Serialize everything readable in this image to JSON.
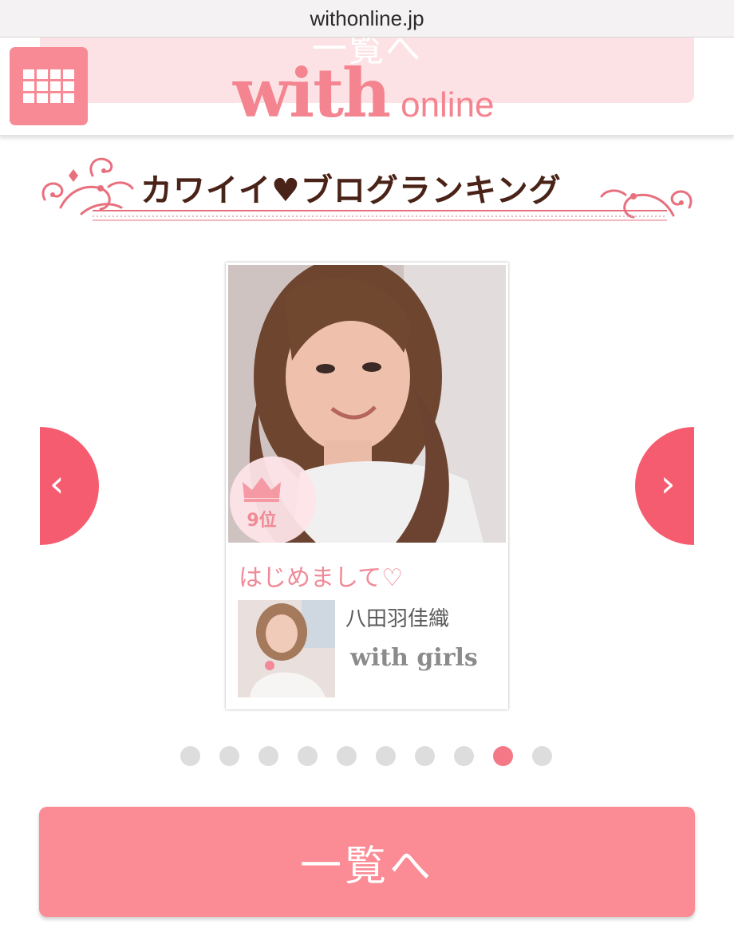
{
  "browser": {
    "url": "withonline.jp"
  },
  "header": {
    "logo_main": "with",
    "logo_sub": "online",
    "ghost_banner_text": "一覧へ",
    "menu_icon": "grid-menu-icon"
  },
  "section": {
    "title": "カワイイ♥ブログランキング"
  },
  "carousel": {
    "prev_icon": "chevron-left-icon",
    "next_icon": "chevron-right-icon",
    "prev_label": "‹",
    "next_label": "›",
    "active_index": 8,
    "total": 10
  },
  "card": {
    "rank": "9位",
    "rank_icon": "crown-icon",
    "post_title": "はじめまして♡",
    "author": "八田羽佳織",
    "brand": "with girls"
  },
  "button": {
    "label": "一覧へ"
  },
  "colors": {
    "accent": "#fb8b95",
    "arrow": "#f65c70",
    "dot_active": "#f47885",
    "dot_inactive": "#dddddd",
    "title_text": "#4a2318"
  }
}
